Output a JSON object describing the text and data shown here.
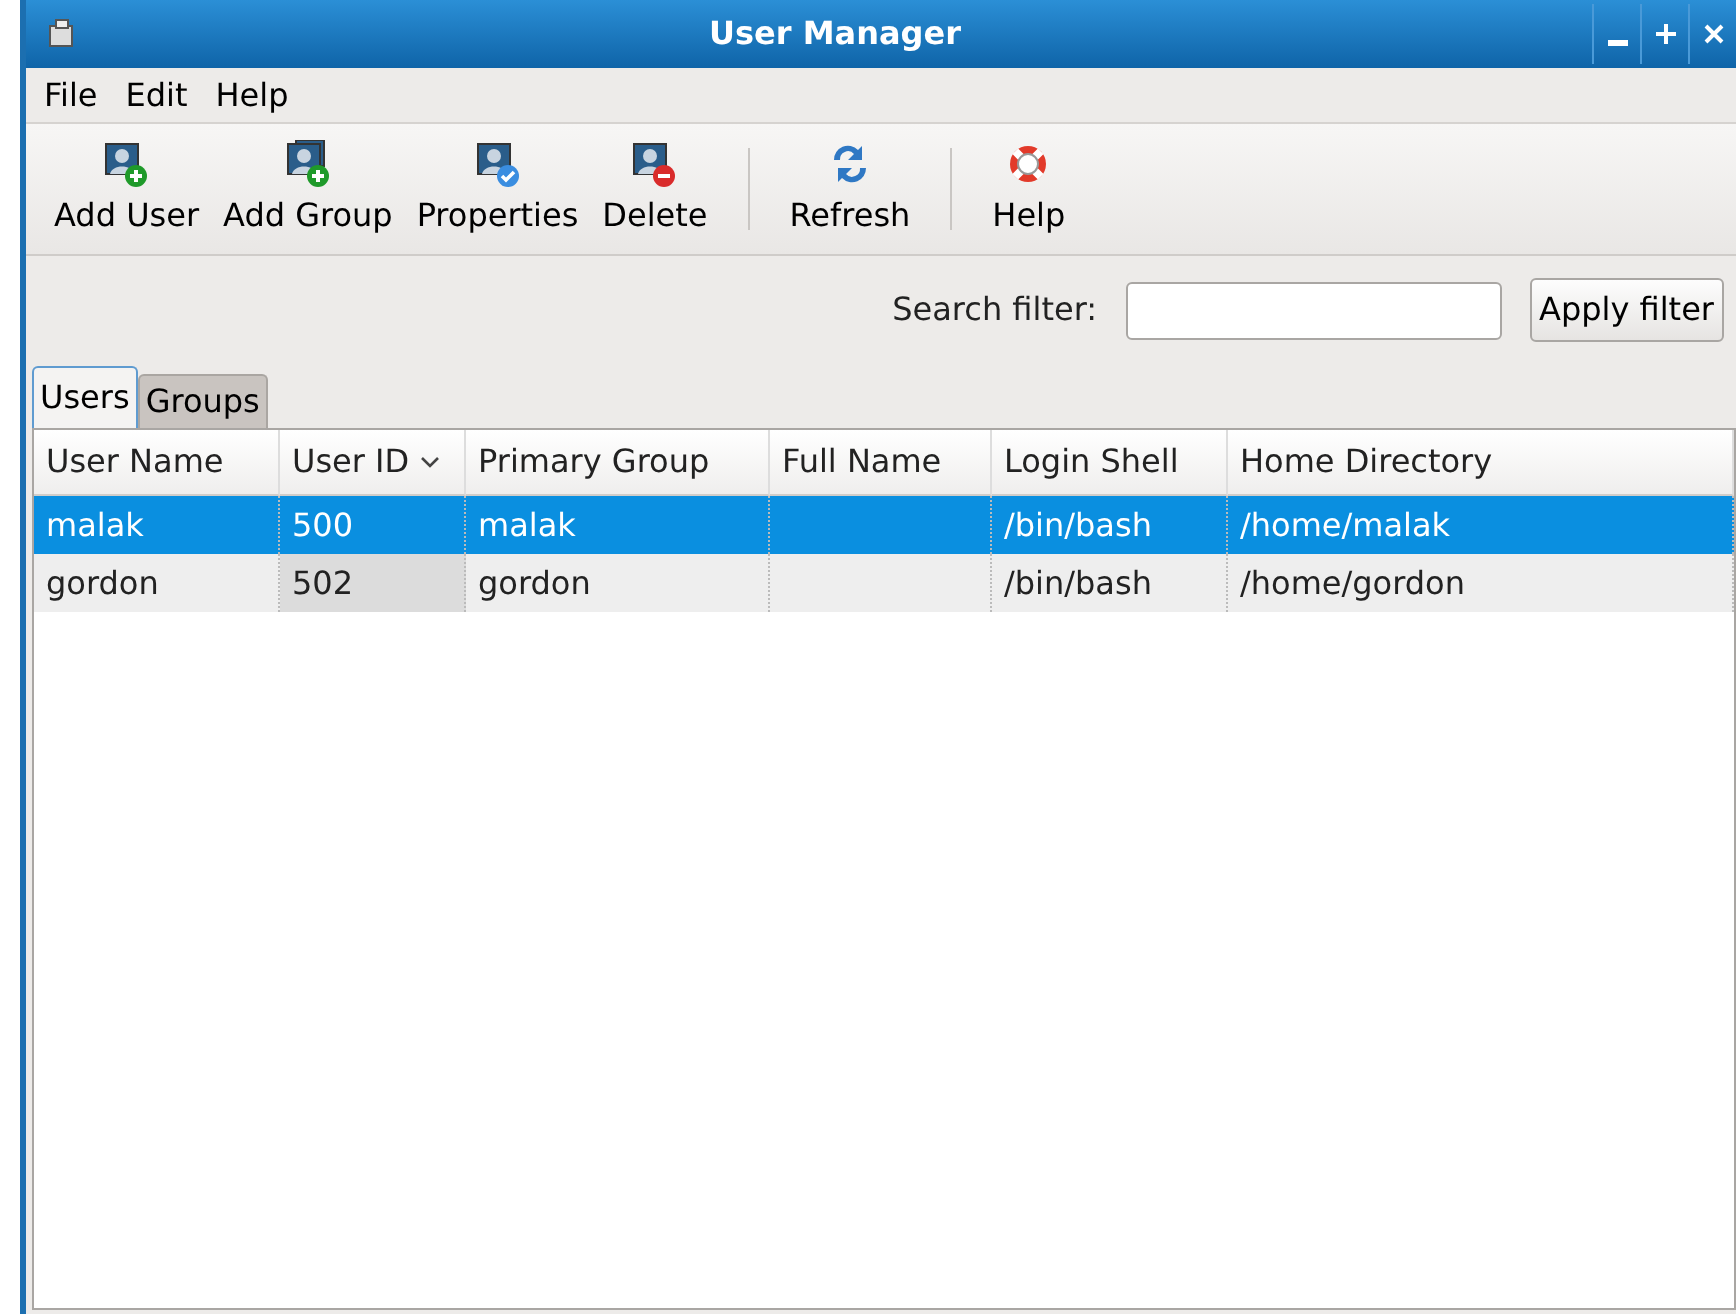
{
  "window": {
    "title": "User Manager"
  },
  "menu": [
    {
      "label": "File"
    },
    {
      "label": "Edit"
    },
    {
      "label": "Help"
    }
  ],
  "toolbar": [
    {
      "label": "Add User",
      "kind": "add-user"
    },
    {
      "label": "Add Group",
      "kind": "add-group"
    },
    {
      "label": "Properties",
      "kind": "properties"
    },
    {
      "label": "Delete",
      "kind": "delete"
    },
    {
      "label": "Refresh",
      "kind": "refresh"
    },
    {
      "label": "Help",
      "kind": "help"
    }
  ],
  "filter": {
    "label": "Search filter:",
    "button": "Apply filter"
  },
  "tabs": [
    {
      "label": "Users",
      "selected": true
    },
    {
      "label": "Groups",
      "selected": false
    }
  ],
  "table": {
    "columns": [
      {
        "label": "User Name",
        "sorted": false
      },
      {
        "label": "User ID",
        "sorted": true
      },
      {
        "label": "Primary Group",
        "sorted": false
      },
      {
        "label": "Full Name",
        "sorted": false
      },
      {
        "label": "Login Shell",
        "sorted": false
      },
      {
        "label": "Home Directory",
        "sorted": false
      }
    ],
    "rows": [
      {
        "selected": true,
        "cells": [
          "malak",
          "500",
          "malak",
          "",
          "/bin/bash",
          "/home/malak"
        ]
      },
      {
        "selected": false,
        "cells": [
          "gordon",
          "502",
          "gordon",
          "",
          "/bin/bash",
          "/home/gordon"
        ]
      }
    ]
  }
}
